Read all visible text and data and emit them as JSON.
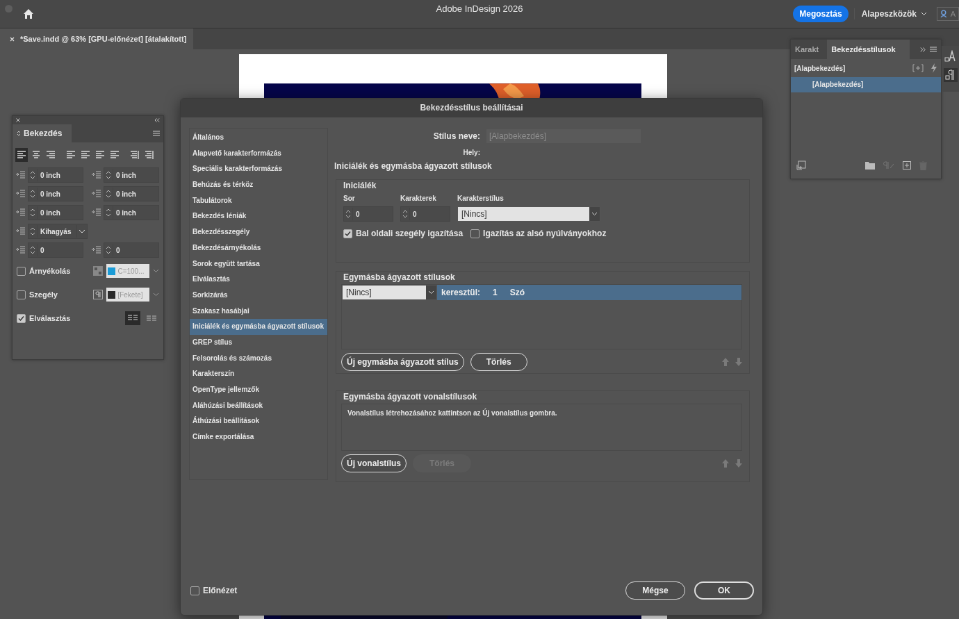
{
  "app": {
    "title": "Adobe InDesign 2026",
    "share_button": "Megosztás",
    "workspace": "Alapeszközök",
    "search_placeholder": "A"
  },
  "document_tab": {
    "title": "*Save.indd @ 63% [GPU-előnézet] [átalakított]"
  },
  "paragraph_panel": {
    "title": "Bekezdés",
    "alignments": [
      {
        "selected": true
      },
      {
        "selected": false
      },
      {
        "selected": false
      },
      {
        "selected": false
      },
      {
        "selected": false
      },
      {
        "selected": false
      },
      {
        "selected": false
      },
      {
        "selected": false
      },
      {
        "selected": false
      }
    ],
    "fields": [
      {
        "kind": "spin",
        "value": "0 inch"
      },
      {
        "kind": "spin",
        "value": "0 inch"
      },
      {
        "kind": "spin",
        "value": "0 inch"
      },
      {
        "kind": "spin",
        "value": "0 inch"
      },
      {
        "kind": "spin",
        "value": "0 inch"
      },
      {
        "kind": "spin",
        "value": "0 inch"
      },
      {
        "kind": "dropdown",
        "value": "Kihagyás"
      },
      {
        "kind": "gap"
      },
      {
        "kind": "spin",
        "value": "0"
      },
      {
        "kind": "spin",
        "value": "0"
      }
    ],
    "shading": {
      "label": "Árnyékolás",
      "checked": false,
      "swatch": "C=100...",
      "color": "#1a9bd6"
    },
    "border": {
      "label": "Szegély",
      "checked": false,
      "swatch": "[Fekete]",
      "color": "#2b2b2b"
    },
    "hyphenation": {
      "label": "Elválasztás",
      "checked": true
    }
  },
  "styles_panel": {
    "tabs": [
      {
        "label": "Karakt",
        "selected": false
      },
      {
        "label": "Bekezdésstílusok",
        "selected": true
      }
    ],
    "header": "[Alapbekezdés]",
    "items": [
      {
        "label": "[Alapbekezdés]",
        "selected": true
      }
    ]
  },
  "dialog": {
    "title": "Bekezdésstílus beállításai",
    "categories": [
      {
        "label": "Általános",
        "selected": false
      },
      {
        "label": "Alapvető karakterformázás",
        "selected": false
      },
      {
        "label": "Speciális karakterformázás",
        "selected": false
      },
      {
        "label": "Behúzás és térköz",
        "selected": false
      },
      {
        "label": "Tabulátorok",
        "selected": false
      },
      {
        "label": "Bekezdés léniák",
        "selected": false
      },
      {
        "label": "Bekezdésszegély",
        "selected": false
      },
      {
        "label": "Bekezdésárnyékolás",
        "selected": false
      },
      {
        "label": "Sorok együtt tartása",
        "selected": false
      },
      {
        "label": "Elválasztás",
        "selected": false
      },
      {
        "label": "Sorkizárás",
        "selected": false
      },
      {
        "label": "Szakasz hasábjai",
        "selected": false
      },
      {
        "label": "Iniciálék és egymásba ágyazott stílusok",
        "selected": true
      },
      {
        "label": "GREP stílus",
        "selected": false
      },
      {
        "label": "Felsorolás és számozás",
        "selected": false
      },
      {
        "label": "Karakterszín",
        "selected": false
      },
      {
        "label": "OpenType jellemzők",
        "selected": false
      },
      {
        "label": "Aláhúzási beállítások",
        "selected": false
      },
      {
        "label": "Áthúzási beállítások",
        "selected": false
      },
      {
        "label": "Címke exportálása",
        "selected": false
      }
    ],
    "style_name_label": "Stílus neve:",
    "style_name_value": "[Alapbekezdés]",
    "location_label": "Hely:",
    "section_title": "Iniciálék és egymásba ágyazott stílusok",
    "drop_caps": {
      "title": "Iniciálék",
      "lines_label": "Sor",
      "lines": "0",
      "chars_label": "Karakterek",
      "chars": "0",
      "style_label": "Karakterstílus",
      "style": "[Nincs]",
      "left_align": {
        "label": "Bal oldali szegély igazítása",
        "checked": true
      },
      "descenders": {
        "label": "Igazítás az alsó nyúlványokhoz",
        "checked": false
      }
    },
    "nested": {
      "title": "Egymásba ágyazott stílusok",
      "rows": [
        {
          "style": "[Nincs]",
          "through": "keresztül:",
          "count": "1",
          "unit": "Szó",
          "selected": true
        }
      ],
      "new_button": "Új egymásba ágyazott stílus",
      "delete_button": {
        "label": "Törlés",
        "disabled": false
      }
    },
    "line_styles": {
      "title": "Egymásba ágyazott vonalstílusok",
      "hint": "Vonalstílus létrehozásához kattintson az Új vonalstílus gombra.",
      "new_button": "Új vonalstílus",
      "delete_button": {
        "label": "Törlés",
        "disabled": true
      }
    },
    "preview": {
      "label": "Előnézet",
      "checked": false
    },
    "cancel_button": "Mégse",
    "ok_button": "OK"
  }
}
